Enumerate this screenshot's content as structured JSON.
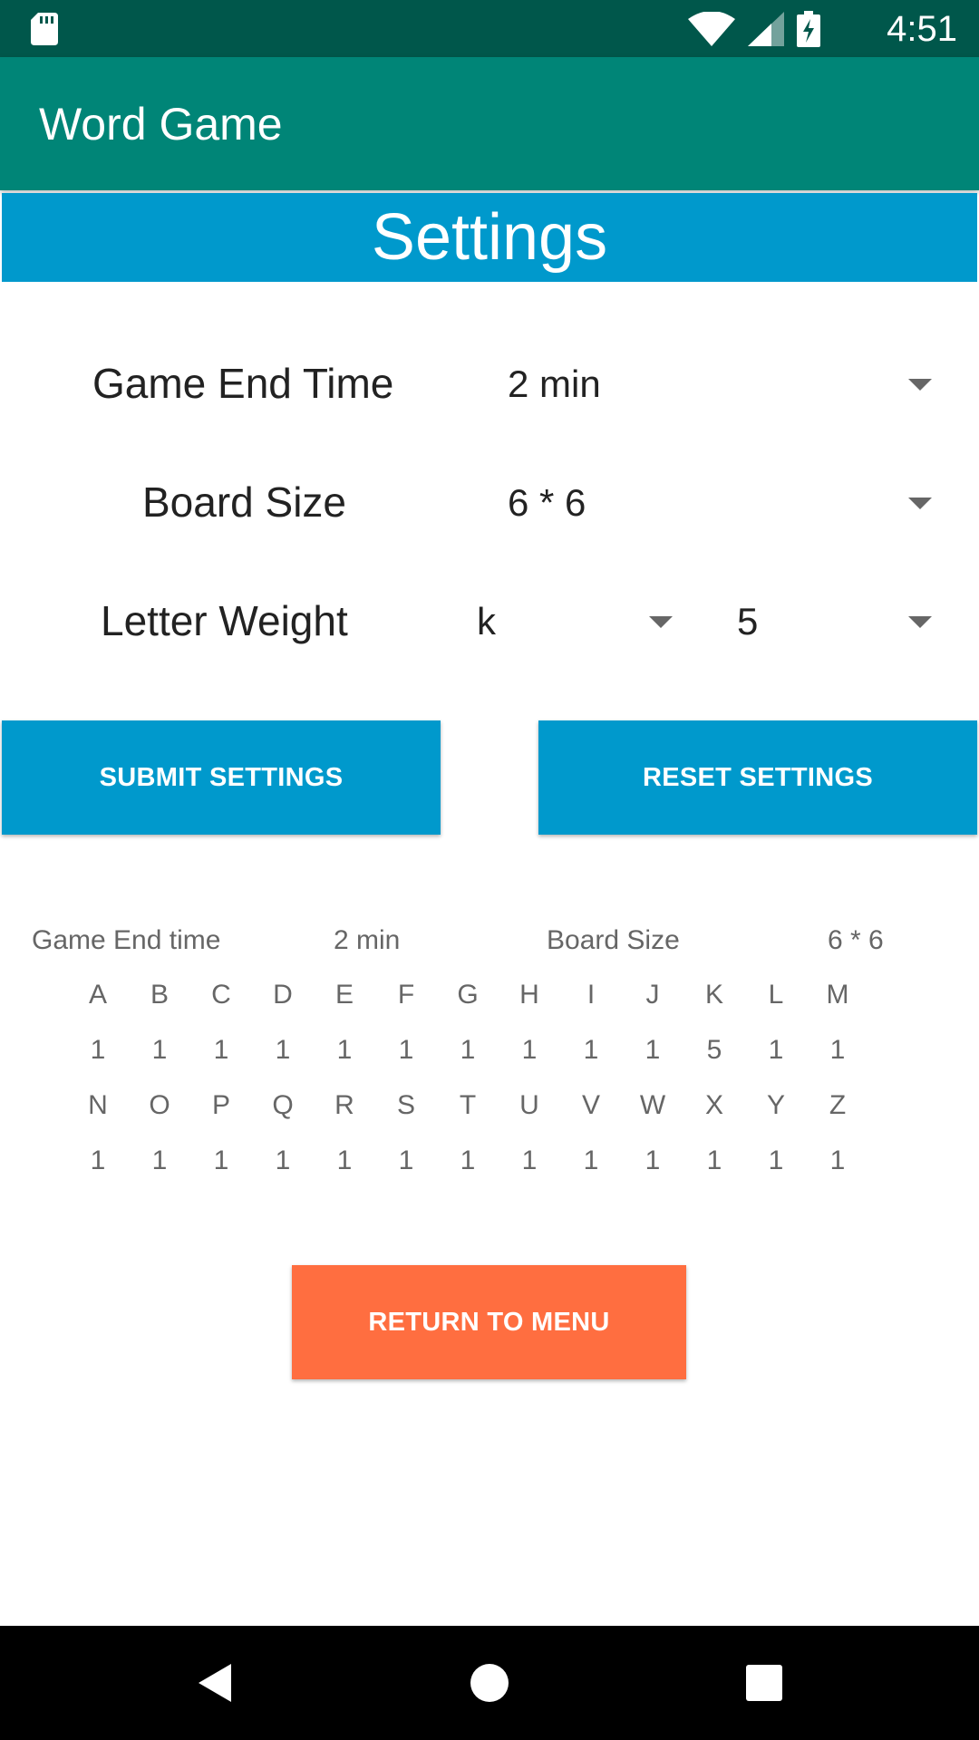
{
  "status_bar": {
    "time": "4:51",
    "icons": [
      "sd-card-icon",
      "wifi-icon",
      "cell-signal-icon",
      "battery-charging-icon"
    ]
  },
  "app_bar": {
    "title": "Word Game"
  },
  "settings_banner": {
    "title": "Settings"
  },
  "form": {
    "game_end_time": {
      "label": "Game End Time",
      "value": "2 min"
    },
    "board_size": {
      "label": "Board Size",
      "value": "6 * 6"
    },
    "letter_weight": {
      "label": "Letter Weight",
      "letter": "k",
      "weight": "5"
    }
  },
  "buttons": {
    "submit": "SUBMIT SETTINGS",
    "reset": "RESET SETTINGS",
    "return": "RETURN TO MENU"
  },
  "summary": {
    "game_end_label": "Game End time",
    "game_end_value": "2 min",
    "board_size_label": "Board Size",
    "board_size_value": "6 * 6"
  },
  "letter_grid": {
    "row1_letters": [
      "A",
      "B",
      "C",
      "D",
      "E",
      "F",
      "G",
      "H",
      "I",
      "J",
      "K",
      "L",
      "M"
    ],
    "row1_weights": [
      "1",
      "1",
      "1",
      "1",
      "1",
      "1",
      "1",
      "1",
      "1",
      "1",
      "5",
      "1",
      "1"
    ],
    "row2_letters": [
      "N",
      "O",
      "P",
      "Q",
      "R",
      "S",
      "T",
      "U",
      "V",
      "W",
      "X",
      "Y",
      "Z"
    ],
    "row2_weights": [
      "1",
      "1",
      "1",
      "1",
      "1",
      "1",
      "1",
      "1",
      "1",
      "1",
      "1",
      "1",
      "1"
    ]
  },
  "nav_bar": {
    "icons": [
      "back-icon",
      "home-icon",
      "recents-icon"
    ]
  },
  "colors": {
    "status_bar": "#00574b",
    "app_bar": "#008577",
    "primary": "#0099cc",
    "accent": "#ff6e40"
  }
}
